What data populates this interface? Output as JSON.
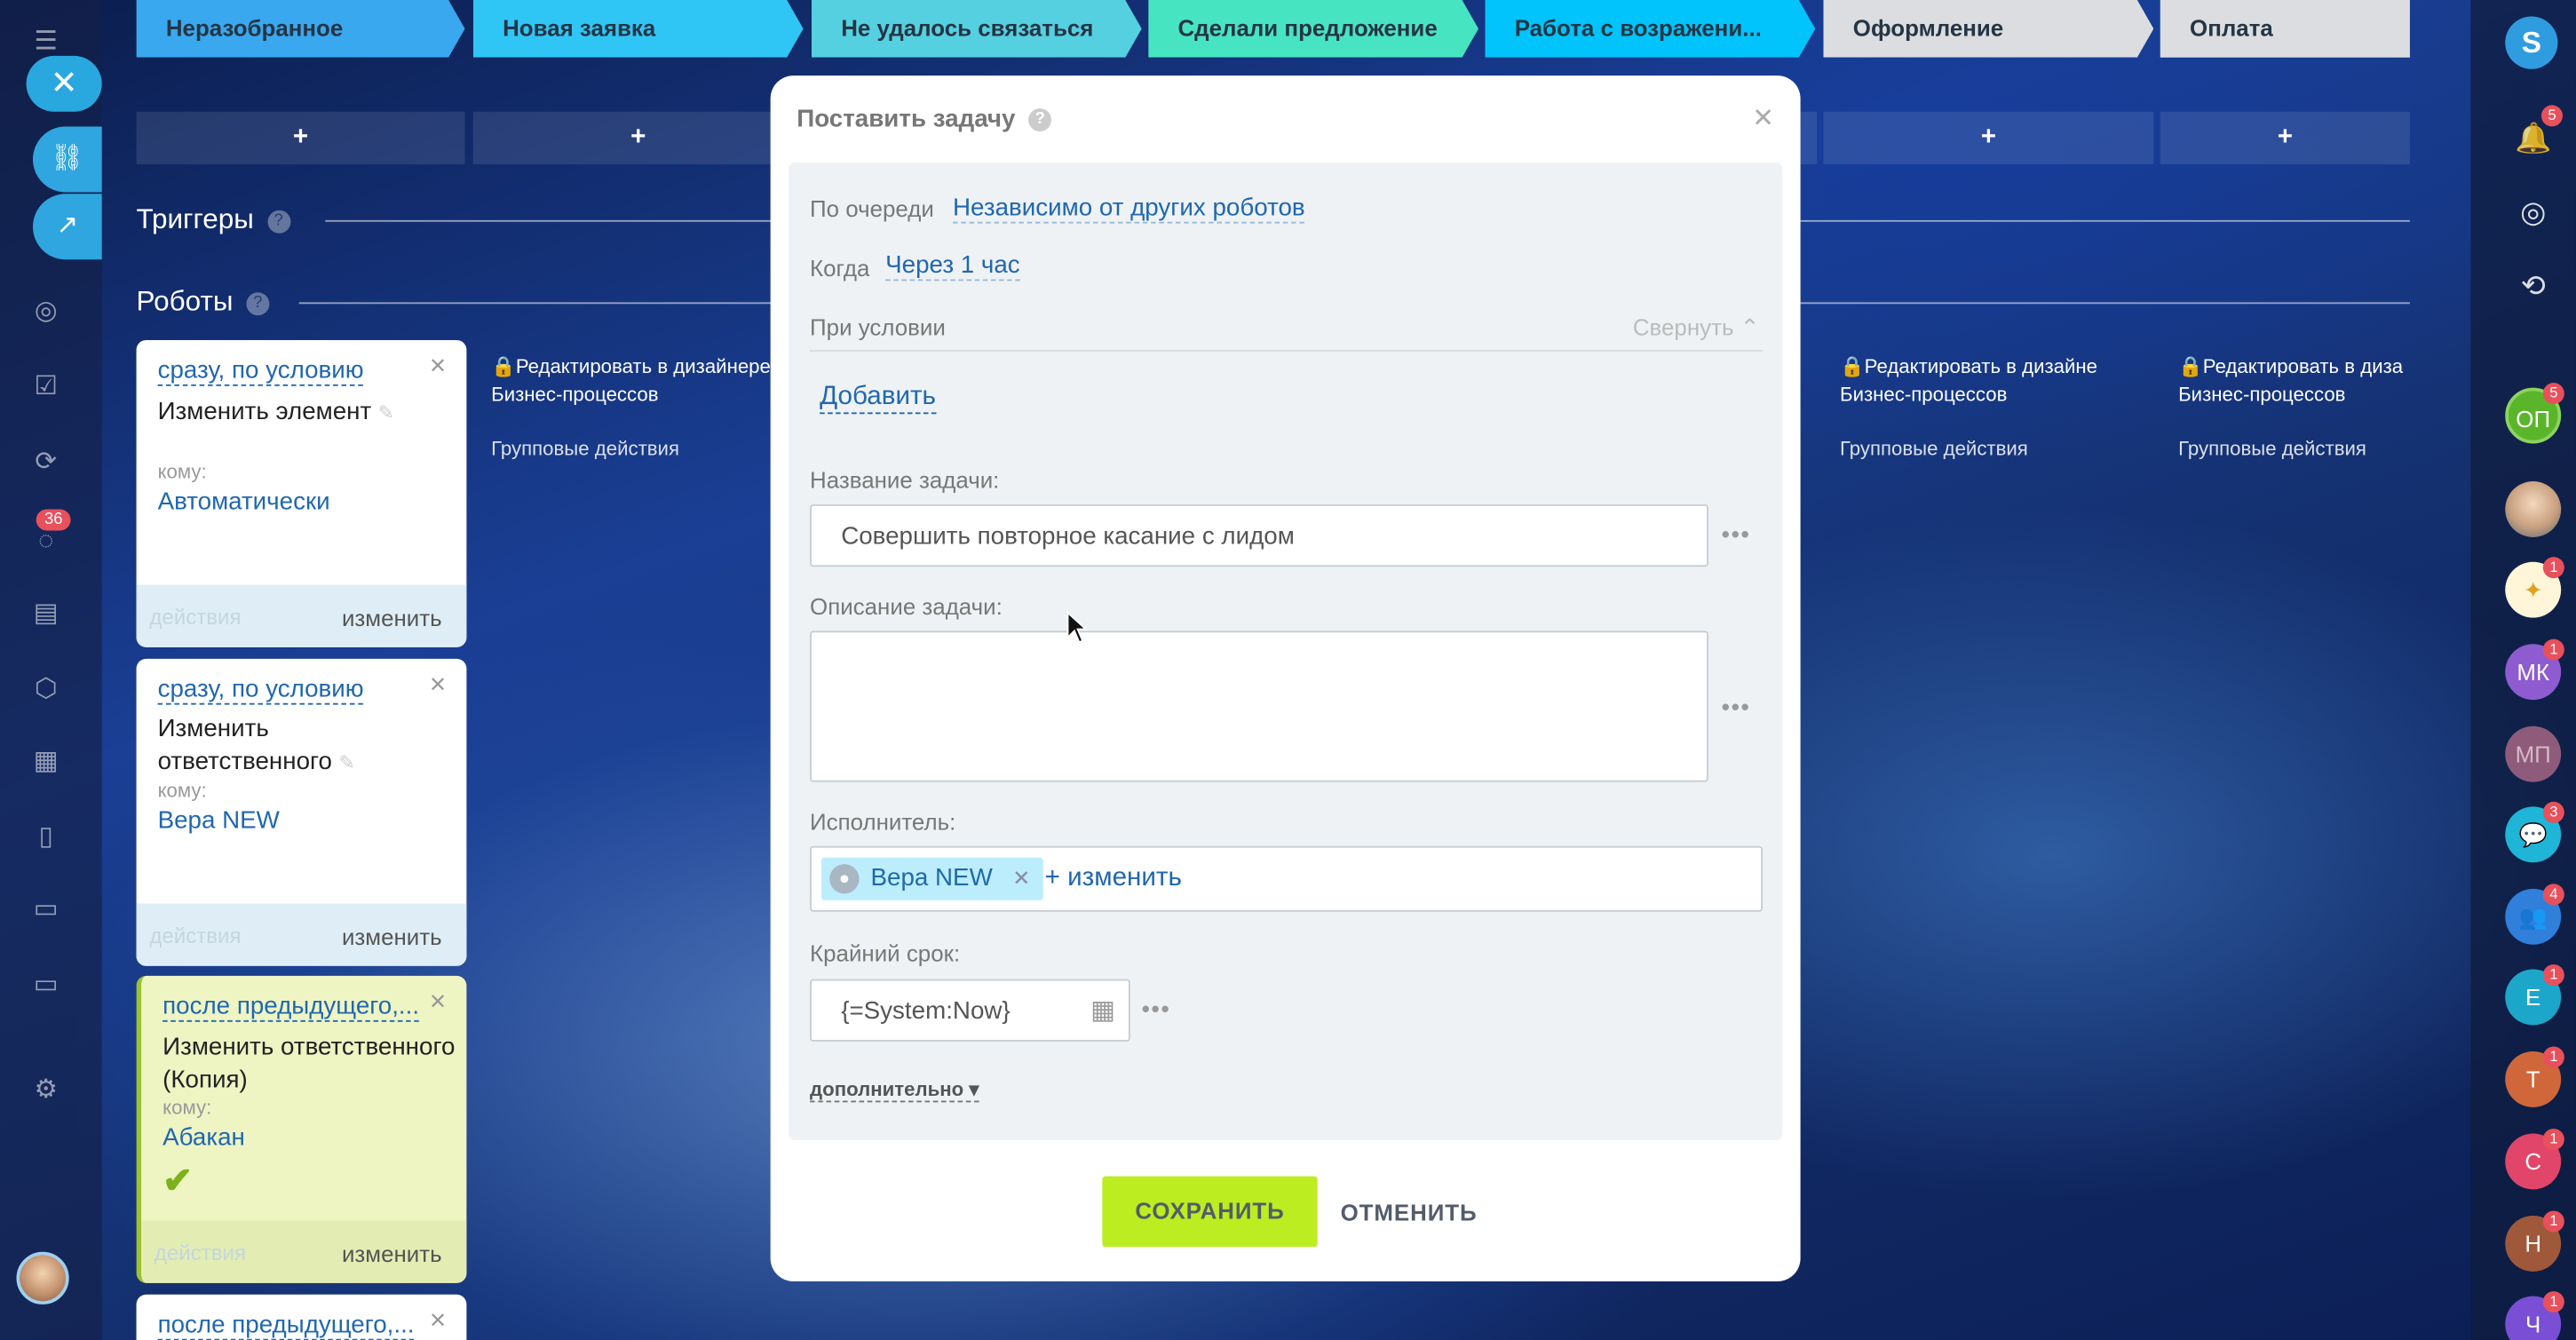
{
  "leftbar": {
    "close_icon": "close-icon",
    "badge": "36"
  },
  "stages": [
    {
      "label": "Неразобранное",
      "color": "#39a8ef"
    },
    {
      "label": "Новая заявка",
      "color": "#2fc6f6"
    },
    {
      "label": "Не удалось связаться",
      "color": "#55d0e0"
    },
    {
      "label": "Сделали предложение",
      "color": "#47e4c2"
    },
    {
      "label": "Работа с возражени...",
      "color": "#00c4fb"
    },
    {
      "label": "Оформление",
      "color": "#dbdde0"
    },
    {
      "label": "Оплата",
      "color": "#dbdde0"
    }
  ],
  "plus": "+",
  "triggers_title": "Триггеры",
  "robots_title": "Роботы",
  "hint_mark": "?",
  "robots": [
    {
      "when": "сразу, по условию",
      "title": "Изменить элемент",
      "whom_label": "кому:",
      "user": "Автоматически",
      "actions": "действия",
      "edit": "изменить"
    },
    {
      "when": "сразу, по условию",
      "title": "Изменить ответственного",
      "whom_label": "кому:",
      "user": "Вера NEW",
      "actions": "действия",
      "edit": "изменить"
    },
    {
      "when": "после предыдущего,...",
      "title": "Изменить ответственного (Копия)",
      "whom_label": "кому:",
      "user": "Абакан",
      "actions": "действия",
      "edit": "изменить"
    },
    {
      "when": "после предыдущего,..."
    }
  ],
  "design_link": {
    "line1": "Редактировать в дизайнере",
    "line2": "Бизнес-процессов",
    "line1_short": "Редактировать в дизайне",
    "line1_short2": "Редактировать в диза"
  },
  "group_actions": "Групповые действия",
  "dialog": {
    "title": "Поставить задачу",
    "order_label": "По очереди",
    "order_value": "Независимо от других роботов",
    "when_label": "Когда",
    "when_value": "Через 1 час",
    "condition_label": "При условии",
    "collapse": "Свернуть",
    "add": "Добавить",
    "task_name_label": "Название задачи:",
    "task_name_value": "Совершить повторное касание с лидом",
    "description_label": "Описание задачи:",
    "description_value": "",
    "assignee_label": "Исполнитель:",
    "assignee_name": "Вера NEW",
    "assignee_change": "+ изменить",
    "deadline_label": "Крайний срок:",
    "deadline_value": "{=System:Now}",
    "more": "дополнительно",
    "save": "СОХРАНИТЬ",
    "cancel": "ОТМЕНИТЬ",
    "dots": "•••"
  },
  "rightbar": {
    "notif_badge": "5",
    "avatars": [
      {
        "initials": "ОП",
        "color": "#5ab52b",
        "badge": "5"
      },
      {
        "initials": "",
        "color": "#8aa6c8",
        "badge": ""
      },
      {
        "initials": "",
        "color": "#f2c14a",
        "badge": "1"
      },
      {
        "initials": "МК",
        "color": "#8e5bd0",
        "badge": "1"
      },
      {
        "initials": "МП",
        "color": "#8e5b7a",
        "badge": ""
      },
      {
        "initials": "",
        "color": "#1fb5d6",
        "badge": "3"
      },
      {
        "initials": "",
        "color": "#2f7fdb",
        "badge": "4"
      },
      {
        "initials": "Е",
        "color": "#1ca6c9",
        "badge": "1"
      },
      {
        "initials": "Т",
        "color": "#d0673a",
        "badge": "1"
      },
      {
        "initials": "С",
        "color": "#e1456a",
        "badge": "1"
      },
      {
        "initials": "Н",
        "color": "#a0583a",
        "badge": "1"
      },
      {
        "initials": "Ч",
        "color": "#7a4fd6",
        "badge": "1"
      }
    ]
  }
}
